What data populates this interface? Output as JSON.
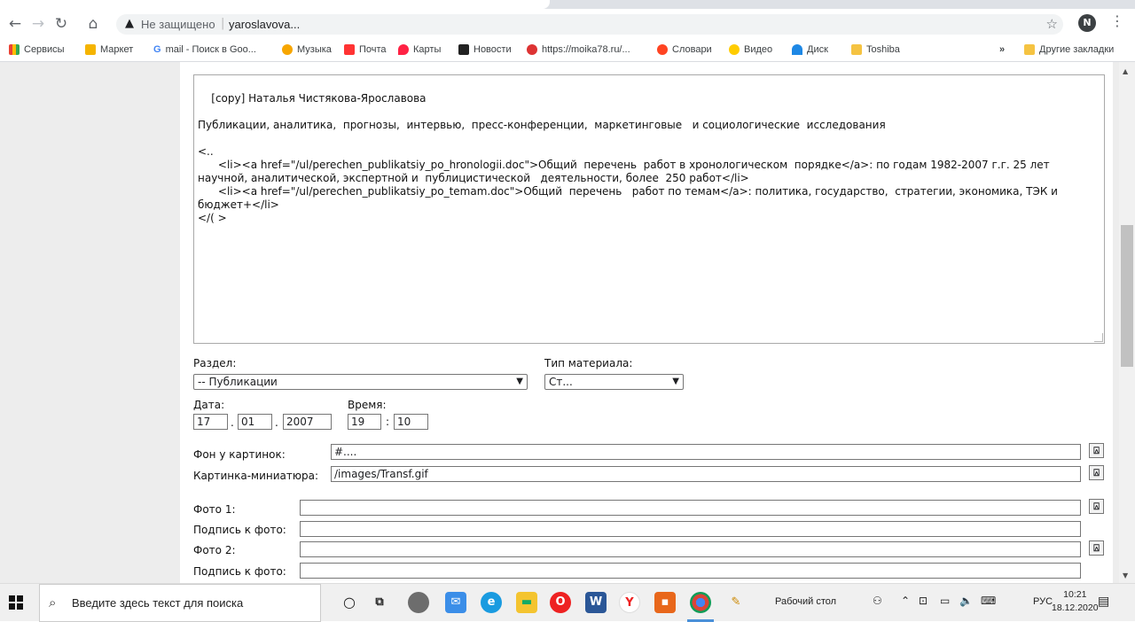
{
  "browser": {
    "url_warning": "Не защищено",
    "url": "yaroslavova...",
    "avatar_letter": "N",
    "bookmarks": [
      "Сервисы",
      "Маркет",
      "mail - Поиск в Goo...",
      "Музыка",
      "Почта",
      "Карты",
      "Новости",
      "https://moika78.ru/...",
      "Словари",
      "Видео",
      "Диск",
      "Toshiba"
    ],
    "other_bookmarks": "Другие закладки",
    "more_bookmarks": "»"
  },
  "editor": {
    "content": "[copy] Наталья Чистякова-Ярославова\n\nПубликации, аналитика,  прогнозы,  интервью,  пресс-конференции,  маркетинговые   и социологические  исследования\n\n<..\n      <li><a href=\"/ul/perechen_publikatsiy_po_hronologii.doc\">Общий  перечень  работ в хронологическом  порядке</a>: по годам 1982-2007 г.г. 25 лет научной, аналитической, экспертной и  публицистической   деятельности, более  250 работ</li>\n      <li><a href=\"/ul/perechen_publikatsiy_po_temam.doc\">Общий  перечень   работ по темам</a>: политика, государство,  стратегии, экономика, ТЭК и бюджет+</li>\n</( >"
  },
  "form": {
    "section_label": "Раздел:",
    "section_value": "-- Публикации",
    "type_label": "Тип материала:",
    "type_value": "Ст...",
    "date_label": "Дата:",
    "date_day": "17",
    "date_month": "01",
    "date_year": "2007",
    "date_sep": ".",
    "time_label": "Время:",
    "time_hour": "19",
    "time_min": "10",
    "time_sep": ":",
    "bg_label": "Фон у картинок:",
    "bg_value": "#....",
    "thumb_label": "Картинка-миниатюра:",
    "thumb_value": "/images/Transf.gif",
    "photo1_label": "Фото 1:",
    "photo1_value": "",
    "caption1_label": "Подпись к фото:",
    "caption1_value": "",
    "photo2_label": "Фото 2:",
    "photo2_value": "",
    "caption2_label": "Подпись к фото:",
    "caption2_value": "",
    "upload_glyph": "⍓"
  },
  "taskbar": {
    "search_placeholder": "Введите здесь текст для поиска",
    "desktop_label": "Рабочий стол",
    "lang": "РУС",
    "time": "10:21",
    "date": "18.12.2020"
  }
}
